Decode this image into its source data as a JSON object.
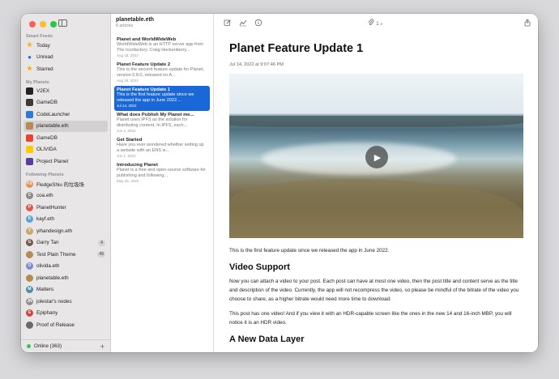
{
  "sidebar": {
    "sections": {
      "smart_feeds": "Smart Feeds",
      "my_planets": "My Planets",
      "following_planets": "Following Planets"
    },
    "smart_feeds": [
      {
        "label": "Today",
        "icon": "sun-icon",
        "color": "#f5a623"
      },
      {
        "label": "Unread",
        "icon": "unread-dot-icon",
        "color": "#1a6fe0"
      },
      {
        "label": "Starred",
        "icon": "star-icon",
        "color": "#f5b400"
      }
    ],
    "my_planets": [
      {
        "label": "V2EX",
        "icon": "v2ex-icon",
        "color": "#222222"
      },
      {
        "label": "GameDB",
        "icon": "gamedb-icon",
        "color": "#3b3b3b"
      },
      {
        "label": "CodeLauncher",
        "icon": "codelauncher-icon",
        "color": "#2e7bd6"
      },
      {
        "label": "planetable.eth",
        "icon": "planet-logo-icon",
        "color": "#b58b55",
        "selected": true
      },
      {
        "label": "GameDB",
        "icon": "gamedb-icon",
        "color": "#e8432e"
      },
      {
        "label": "OLIVIDA",
        "icon": "olivida-icon",
        "color": "#ffcc00"
      },
      {
        "label": "Project Planet",
        "icon": "project-planet-icon",
        "color": "#5a3e9e"
      }
    ],
    "following_planets": [
      {
        "label": "FledgeShiu 的垃圾场",
        "icon": "avatar-icon",
        "initial": "FS",
        "color": "#e98e55"
      },
      {
        "label": "coa.eth",
        "icon": "avatar-icon",
        "initial": "C",
        "color": "#8a8a8a"
      },
      {
        "label": "PlanetHunter",
        "icon": "avatar-icon",
        "initial": "P",
        "color": "#e05a4f"
      },
      {
        "label": "kayf.eth",
        "icon": "avatar-icon",
        "initial": "K",
        "color": "#5aa0e0"
      },
      {
        "label": "yihandesign.eth",
        "icon": "avatar-icon",
        "initial": "Y",
        "color": "#c9a86a"
      },
      {
        "label": "Garry Tan",
        "icon": "avatar-icon",
        "initial": "G",
        "color": "#6e5b4a",
        "badge": "4"
      },
      {
        "label": "Test Plain Theme",
        "icon": "planet-logo-icon",
        "initial": "",
        "color": "#b58b55",
        "badge": "49"
      },
      {
        "label": "olivida.eth",
        "icon": "avatar-icon",
        "initial": "O",
        "color": "#7d8bd6"
      },
      {
        "label": "planetable.eth",
        "icon": "planet-logo-icon",
        "initial": "",
        "color": "#b58b55"
      },
      {
        "label": "Matters",
        "icon": "avatar-icon",
        "initial": "M",
        "color": "#4b8fa3"
      },
      {
        "label": "jolestar's nodes",
        "icon": "avatar-icon",
        "initial": "JN",
        "color": "#8f8f8f"
      },
      {
        "label": "Epiphany",
        "icon": "avatar-icon",
        "initial": "E",
        "color": "#d8453a"
      },
      {
        "label": "Proof of Release",
        "icon": "avatar-icon",
        "initial": "",
        "color": "#6a6a6a"
      }
    ],
    "footer": {
      "status": "Online (363)",
      "add_label": "+"
    }
  },
  "list": {
    "title": "planetable.eth",
    "subtitle": "6 articles",
    "articles": [
      {
        "title": "Planet and WorldWideWeb",
        "snippet": "WorldWideWeb is an HTTP server app from The Iconfactory. Craig Hockenberry...",
        "date": "Aug 18, 2022"
      },
      {
        "title": "Planet Feature Update 2",
        "snippet": "This is the second feature update for Planet, version 0.8.0, released on A...",
        "date": "Aug 16, 2022"
      },
      {
        "title": "Planet Feature Update 1",
        "snippet": "This is the first feature update since we released the app in June 2022....",
        "date": "Jul 14, 2022",
        "selected": true
      },
      {
        "title": "What does Publish My Planet me...",
        "snippet": "Planet uses IPFS as the solution for distributing content. In IPFS, each...",
        "date": "Jun 1, 2022"
      },
      {
        "title": "Get Started",
        "snippet": "Have you ever wondered whether setting up a website with an ENS is...",
        "date": "Jun 1, 2022"
      },
      {
        "title": "Introducing Planet",
        "snippet": "Planet is a free and open-source software for publishing and following...",
        "date": "May 25, 2022"
      }
    ]
  },
  "toolbar": {
    "attachment_count": "1"
  },
  "article": {
    "title": "Planet Feature Update 1",
    "date": "Jul 14, 2022 at 9:07:46 PM",
    "intro": "This is the first feature update since we released the app in June 2022.",
    "h_video": "Video Support",
    "p_video": "Now you can attach a video to your post. Each post can have at most one video, then the post title and content serve as the title and description of the video. Currently, the app will not recompress the video, so please be mindful of the bitrate of the video you choose to share, as a higher bitrate would need more time to download.",
    "p_hdr": "This post has one video! And if you view it with an HDR-capable screen like the ones in the new 14 and 16-inch MBP, you will notice it is an HDR video.",
    "h_data": "A New Data Layer"
  },
  "colors": {
    "accent": "#1a67d7",
    "sidebar_bg": "#e8e6e6"
  }
}
